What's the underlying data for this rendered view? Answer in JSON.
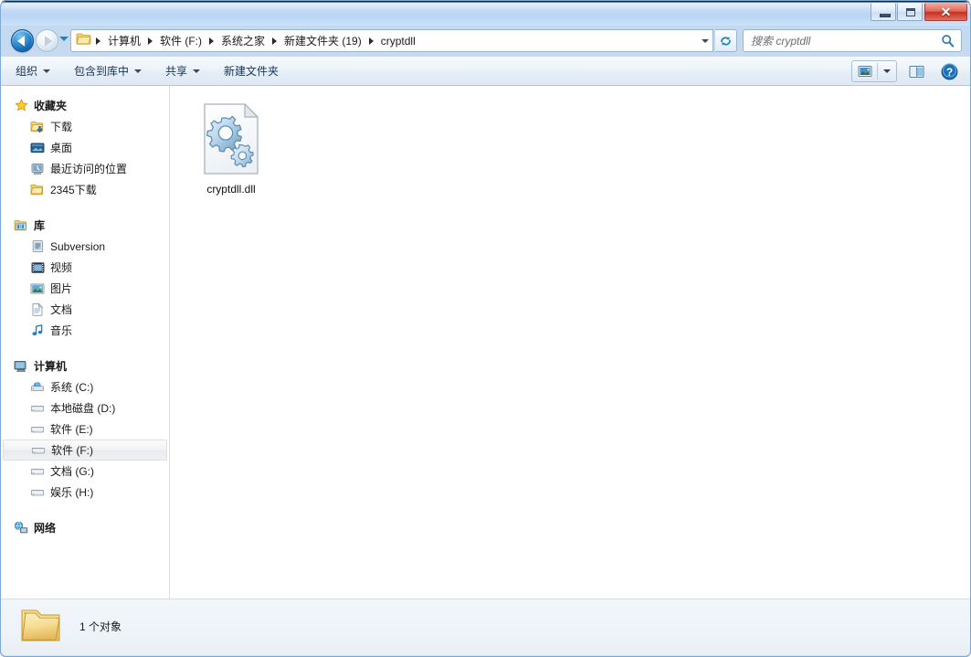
{
  "window": {
    "titlebar_color": "#b6d3f2",
    "close_color": "#c62f20",
    "minimize_label": "最小化",
    "maximize_label": "最大化",
    "close_label": "✕"
  },
  "nav": {
    "back_label": "后退",
    "forward_label": "前进",
    "history_label": "最近浏览的位置",
    "refresh_label": "刷新"
  },
  "address": {
    "folder_icon": "folder-icon",
    "crumbs": [
      {
        "label": "计算机"
      },
      {
        "label": "软件 (F:)"
      },
      {
        "label": "系统之家"
      },
      {
        "label": "新建文件夹 (19)"
      },
      {
        "label": "cryptdll"
      }
    ]
  },
  "search": {
    "placeholder": "搜索 cryptdll",
    "value": "",
    "icon": "search-icon"
  },
  "toolbar": {
    "items": [
      {
        "label": "组织",
        "caret": true
      },
      {
        "label": "包含到库中",
        "caret": true
      },
      {
        "label": "共享",
        "caret": true
      },
      {
        "label": "新建文件夹",
        "caret": false
      }
    ],
    "view_label": "更改您的视图",
    "preview_label": "显示预览窗格",
    "help_label": "获取帮助"
  },
  "sidebar": {
    "groups": [
      {
        "header": {
          "label": "收藏夹",
          "icon": "star-icon"
        },
        "items": [
          {
            "label": "下载",
            "icon": "downloads-folder-icon"
          },
          {
            "label": "桌面",
            "icon": "desktop-icon"
          },
          {
            "label": "最近访问的位置",
            "icon": "recent-places-icon"
          },
          {
            "label": "2345下载",
            "icon": "folder-icon"
          }
        ]
      },
      {
        "header": {
          "label": "库",
          "icon": "library-icon"
        },
        "items": [
          {
            "label": "Subversion",
            "icon": "subversion-icon"
          },
          {
            "label": "视频",
            "icon": "video-icon"
          },
          {
            "label": "图片",
            "icon": "pictures-icon"
          },
          {
            "label": "文档",
            "icon": "documents-icon"
          },
          {
            "label": "音乐",
            "icon": "music-icon"
          }
        ]
      },
      {
        "header": {
          "label": "计算机",
          "icon": "computer-icon"
        },
        "items": [
          {
            "label": "系统 (C:)",
            "icon": "system-drive-icon",
            "selected": false
          },
          {
            "label": "本地磁盘 (D:)",
            "icon": "drive-icon",
            "selected": false
          },
          {
            "label": "软件 (E:)",
            "icon": "drive-icon",
            "selected": false
          },
          {
            "label": "软件 (F:)",
            "icon": "drive-icon",
            "selected": true
          },
          {
            "label": "文档 (G:)",
            "icon": "drive-icon",
            "selected": false
          },
          {
            "label": "娱乐 (H:)",
            "icon": "drive-icon",
            "selected": false
          }
        ]
      },
      {
        "header": {
          "label": "网络",
          "icon": "network-icon"
        },
        "items": []
      }
    ]
  },
  "content": {
    "files": [
      {
        "name": "cryptdll.dll",
        "icon": "dll-gear-file-icon",
        "selected": false
      }
    ]
  },
  "status": {
    "icon": "folder-large-icon",
    "text": "1 个对象"
  }
}
